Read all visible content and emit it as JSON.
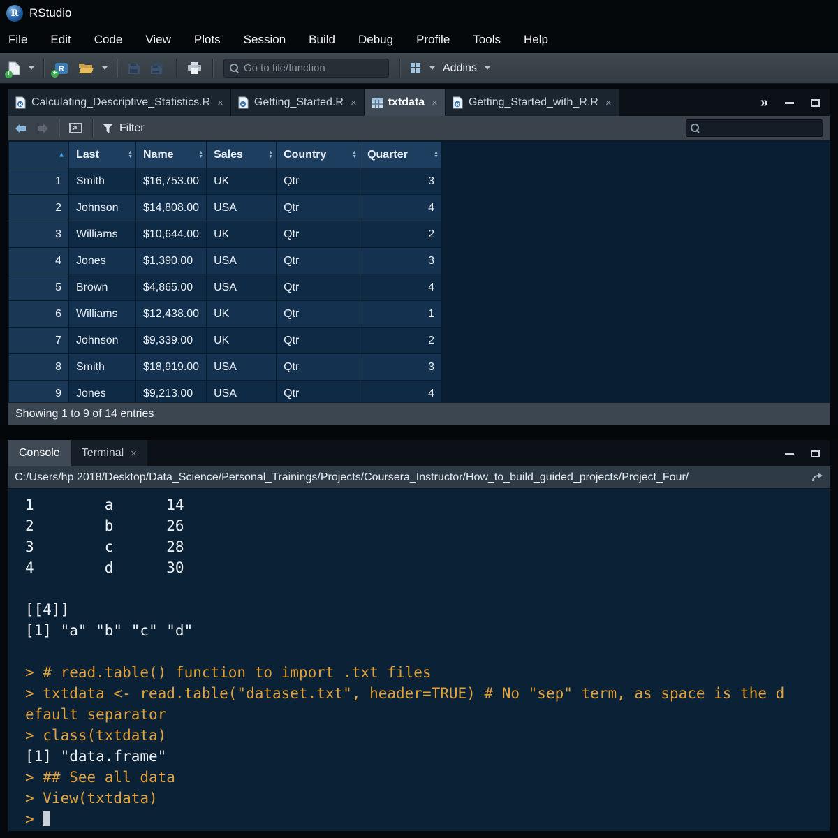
{
  "window": {
    "title": "RStudio"
  },
  "menu": {
    "items": [
      "File",
      "Edit",
      "Code",
      "View",
      "Plots",
      "Session",
      "Build",
      "Debug",
      "Profile",
      "Tools",
      "Help"
    ]
  },
  "toolbar": {
    "goto_placeholder": "Go to file/function",
    "addins_label": "Addins",
    "icons": [
      "new-file",
      "new-project",
      "open-folder",
      "save",
      "save-all",
      "print",
      "addins-grid"
    ]
  },
  "editor_tabs": [
    {
      "label": "Calculating_Descriptive_Statistics.R",
      "icon": "r-file",
      "active": false
    },
    {
      "label": "Getting_Started.R",
      "icon": "r-file",
      "active": false
    },
    {
      "label": "txtdata",
      "icon": "table",
      "active": true
    },
    {
      "label": "Getting_Started_with_R.R",
      "icon": "r-file",
      "active": false
    }
  ],
  "data_viewer": {
    "filter_label": "Filter",
    "status": "Showing 1 to 9 of 14 entries",
    "table": {
      "columns": [
        {
          "label": "",
          "sorted": "asc"
        },
        {
          "label": "Last"
        },
        {
          "label": "Name"
        },
        {
          "label": "Sales"
        },
        {
          "label": "Country"
        },
        {
          "label": "Quarter"
        }
      ],
      "rows": [
        [
          "1",
          "Smith",
          "$16,753.00",
          "UK",
          "Qtr",
          "3"
        ],
        [
          "2",
          "Johnson",
          "$14,808.00",
          "USA",
          "Qtr",
          "4"
        ],
        [
          "3",
          "Williams",
          "$10,644.00",
          "UK",
          "Qtr",
          "2"
        ],
        [
          "4",
          "Jones",
          "$1,390.00",
          "USA",
          "Qtr",
          "3"
        ],
        [
          "5",
          "Brown",
          "$4,865.00",
          "USA",
          "Qtr",
          "4"
        ],
        [
          "6",
          "Williams",
          "$12,438.00",
          "UK",
          "Qtr",
          "1"
        ],
        [
          "7",
          "Johnson",
          "$9,339.00",
          "UK",
          "Qtr",
          "2"
        ],
        [
          "8",
          "Smith",
          "$18,919.00",
          "USA",
          "Qtr",
          "3"
        ],
        [
          "9",
          "Jones",
          "$9,213.00",
          "USA",
          "Qtr",
          "4"
        ]
      ]
    }
  },
  "console": {
    "tabs": [
      {
        "label": "Console",
        "active": true,
        "closable": false
      },
      {
        "label": "Terminal",
        "active": false,
        "closable": true
      }
    ],
    "path": "C:/Users/hp 2018/Desktop/Data_Science/Personal_Trainings/Projects/Coursera_Instructor/How_to_build_guided_projects/Project_Four/",
    "lines": [
      {
        "type": "output",
        "text": "1        a      14"
      },
      {
        "type": "output",
        "text": "2        b      26"
      },
      {
        "type": "output",
        "text": "3        c      28"
      },
      {
        "type": "output",
        "text": "4        d      30"
      },
      {
        "type": "output",
        "text": ""
      },
      {
        "type": "output",
        "text": "[[4]]"
      },
      {
        "type": "output",
        "text": "[1] \"a\" \"b\" \"c\" \"d\""
      },
      {
        "type": "output",
        "text": ""
      },
      {
        "type": "input",
        "text": "> # read.table() function to import .txt files"
      },
      {
        "type": "input",
        "text": "> txtdata <- read.table(\"dataset.txt\", header=TRUE) # No \"sep\" term, as space is the d"
      },
      {
        "type": "input",
        "text": "efault separator"
      },
      {
        "type": "input",
        "text": "> class(txtdata)"
      },
      {
        "type": "output",
        "text": "[1] \"data.frame\""
      },
      {
        "type": "input",
        "text": "> ## See all data"
      },
      {
        "type": "input",
        "text": "> View(txtdata)"
      },
      {
        "type": "input",
        "text": "> ",
        "cursor": true
      }
    ]
  },
  "colors": {
    "console_bg": "#0b2135",
    "console_input_orange": "#e0a23c",
    "active_sort_blue": "#4fa7e8",
    "table_header_blue": "#1d3e5f",
    "active_tab_gray": "#3f4a56"
  }
}
